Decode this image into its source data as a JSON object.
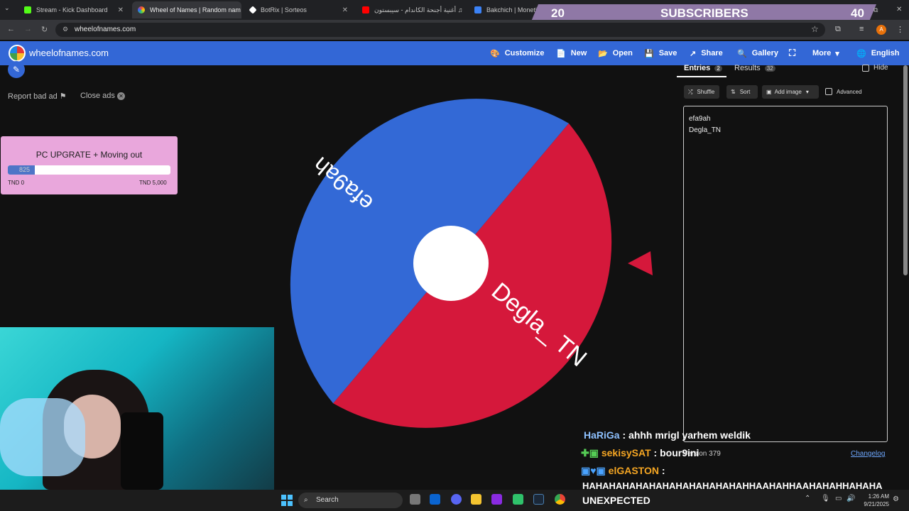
{
  "browser": {
    "tabs": [
      {
        "label": "Stream - Kick Dashboard",
        "color": "#53fc18"
      },
      {
        "label": "Wheel of Names | Random nam",
        "color": "#e44"
      },
      {
        "label": "BotRix | Sorteos",
        "color": "#fff"
      },
      {
        "label": "أغنية أجنحة الكاندام - سيبستون ♫",
        "color": "#f00"
      },
      {
        "label": "Bakchich | Monetiz",
        "color": "#3b82f6"
      }
    ],
    "url": "wheelofnames.com"
  },
  "overlay": {
    "sub_count_left": "20",
    "sub_label": "SUBSCRIBERS",
    "sub_count_right": "40"
  },
  "app": {
    "logo": "wheelofnames.com",
    "nav": [
      {
        "label": "Customize",
        "icon": "palette-icon",
        "glyph": "🎨"
      },
      {
        "label": "New",
        "icon": "file-icon",
        "glyph": "📄"
      },
      {
        "label": "Open",
        "icon": "folder-icon",
        "glyph": "📂"
      },
      {
        "label": "Save",
        "icon": "save-icon",
        "glyph": "💾"
      },
      {
        "label": "Share",
        "icon": "share-icon",
        "glyph": "↗"
      },
      {
        "label": "Gallery",
        "icon": "search-icon",
        "glyph": "🔍"
      },
      {
        "label": "",
        "icon": "fullscreen-icon",
        "glyph": "⛶"
      },
      {
        "label": "More",
        "icon": "chevron-down-icon",
        "glyph": "▾"
      },
      {
        "label": "English",
        "icon": "globe-icon",
        "glyph": "🌐"
      }
    ]
  },
  "left": {
    "report_ad": "Report bad ad",
    "close_ads": "Close ads",
    "donation": {
      "title": "PC UPGRATE + Moving out",
      "current": "825",
      "fraction": 0.165,
      "min_label": "TND 0",
      "max_label": "TND 5,000"
    }
  },
  "wheel": {
    "entries": [
      "efa9ah",
      "Degla_ TN"
    ],
    "colors": [
      "#3369d6",
      "#d5183b"
    ]
  },
  "right": {
    "tab_entries": "Entries",
    "entries_count": "2",
    "tab_results": "Results",
    "results_count": "32",
    "hide_label": "Hide",
    "shuffle": "Shuffle",
    "sort": "Sort",
    "add_image": "Add image",
    "advanced": "Advanced",
    "entries_text": [
      "efa9ah",
      "Degla_TN"
    ],
    "version": "Version 379",
    "changelog": "Changelog"
  },
  "chat": [
    {
      "user": "HaRiGa",
      "user_color": "#8ec1ff",
      "message": "ahhh mrigl yarhem weldik"
    },
    {
      "user": "sekisySAT",
      "user_color": "#f5a623",
      "message": "bour9ini"
    },
    {
      "user": "elGASTON",
      "user_color": "#f5a623",
      "message": ""
    },
    {
      "user": "",
      "user_color": "#fff",
      "message": "HAHAHAHAHAHAHAHAHAHAHAHAHHAAHAHHAAHAHAHHAHAHA"
    }
  ],
  "taskbar": {
    "search": "Search",
    "ticker": "UNEXPECTED",
    "time": "1:26 AM",
    "date": "9/21/2025"
  }
}
